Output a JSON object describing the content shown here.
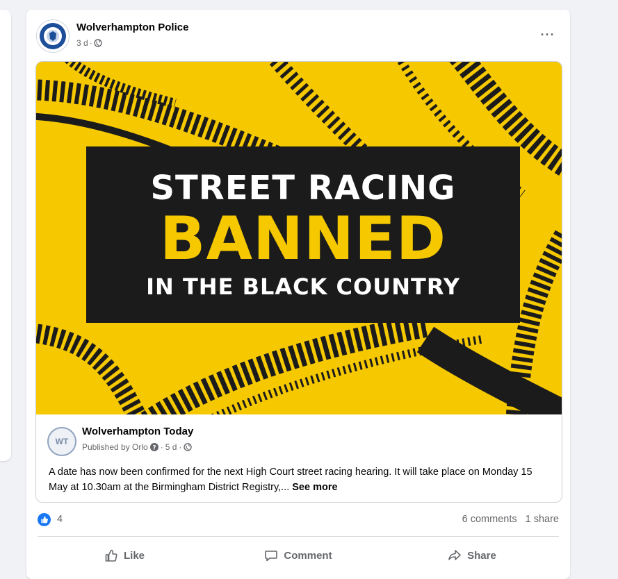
{
  "post": {
    "page_name": "Wolverhampton Police",
    "time": "3 d",
    "audience_icon": "globe-icon",
    "more_icon": "more-options-icon",
    "more_label": "···"
  },
  "promo": {
    "line1": "STREET RACING",
    "line2": "BANNED",
    "line3": "IN THE BLACK COUNTRY",
    "colors": {
      "background": "#f5c800",
      "panel": "#1b1b1b",
      "accent": "#f5c800",
      "text": "#ffffff"
    }
  },
  "shared_post": {
    "page_name": "Wolverhampton Today",
    "avatar_text": "WT",
    "published_by": "Published by Orlo",
    "time": "5 d",
    "text": "A date has now been confirmed for the next High Court street racing hearing. It will take place on Monday 15 May at 10.30am at the Birmingham District Registry,... ",
    "see_more": "See more"
  },
  "stats": {
    "reactions": "4",
    "comments": "6 comments",
    "shares": "1 share"
  },
  "actions": {
    "like": "Like",
    "comment": "Comment",
    "share": "Share"
  }
}
